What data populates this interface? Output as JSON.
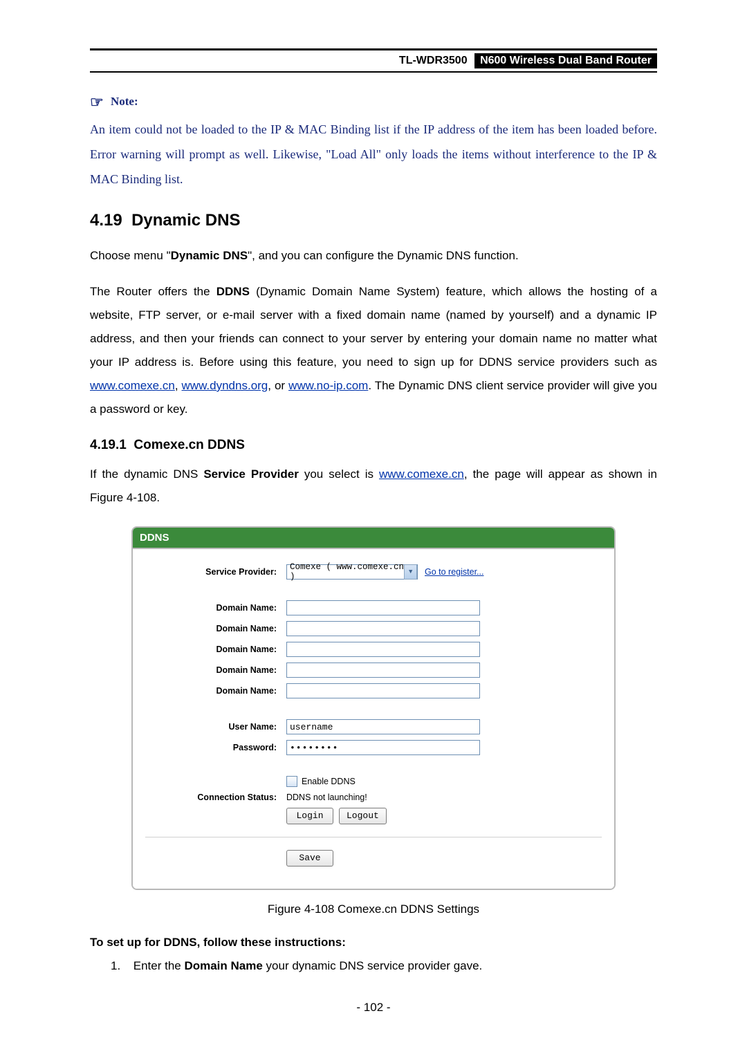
{
  "header": {
    "model": "TL-WDR3500",
    "title": "N600 Wireless Dual Band Router"
  },
  "note": {
    "label": "Note:",
    "body": "An item could not be loaded to the IP & MAC Binding list if the IP address of the item has been loaded before. Error warning will prompt as well. Likewise, \"Load All\" only loads the items without interference to the IP & MAC Binding list."
  },
  "section": {
    "number": "4.19",
    "title": "Dynamic DNS"
  },
  "intro1_prefix": "Choose menu \"",
  "intro1_bold": "Dynamic DNS",
  "intro1_suffix": "\", and you can configure the Dynamic DNS function.",
  "intro2_p1": "The Router offers the ",
  "intro2_b1": "DDNS",
  "intro2_p2": " (Dynamic Domain Name System) feature, which allows the hosting of a website, FTP server, or e-mail server with a fixed domain name (named by yourself) and a dynamic IP address, and then your friends can connect to your server by entering your domain name no matter what your IP address is. Before using this feature, you need to sign up for DDNS service providers such as ",
  "link_comexe": "www.comexe.cn",
  "intro2_p3": ", ",
  "link_dyndns": "www.dyndns.org",
  "intro2_p4": ", or ",
  "link_noip": "www.no-ip.com",
  "intro2_p5": ". The Dynamic DNS client service provider will give you a password or key.",
  "subsection": {
    "number": "4.19.1",
    "title": "Comexe.cn DDNS"
  },
  "sub_p1": "If the dynamic DNS ",
  "sub_b1": "Service Provider",
  "sub_p2": " you select is ",
  "sub_link": "www.comexe.cn",
  "sub_p3": ", the page will appear as shown in Figure 4-108.",
  "ddns": {
    "panel_title": "DDNS",
    "labels": {
      "service_provider": "Service Provider:",
      "domain_name": "Domain Name:",
      "user_name": "User Name:",
      "password": "Password:",
      "connection_status": "Connection Status:"
    },
    "service_provider_value": "Comexe ( www.comexe.cn )",
    "go_register": "Go to register...",
    "domain_values": [
      "",
      "",
      "",
      "",
      ""
    ],
    "username_value": "username",
    "password_value": "••••••••",
    "enable_label": "Enable DDNS",
    "status_value": "DDNS not launching!",
    "buttons": {
      "login": "Login",
      "logout": "Logout",
      "save": "Save"
    }
  },
  "figure_caption": "Figure 4-108 Comexe.cn DDNS Settings",
  "setup_heading": "To set up for DDNS, follow these instructions:",
  "step1_num": "1.",
  "step1_a": "Enter the ",
  "step1_b": "Domain Name",
  "step1_c": " your dynamic DNS service provider gave.",
  "page_number": "- 102 -"
}
